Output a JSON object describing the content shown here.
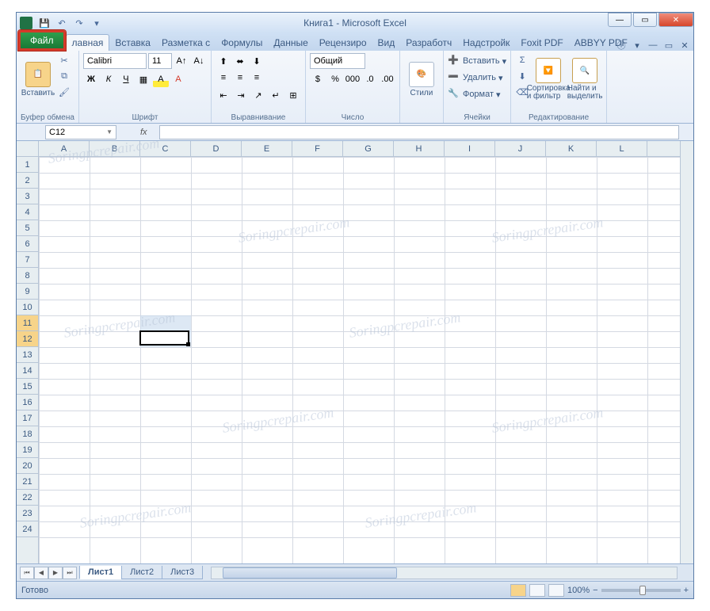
{
  "title": "Книга1 - Microsoft Excel",
  "qat": {
    "save": "💾",
    "undo": "↶",
    "redo": "↷"
  },
  "tabs": {
    "file": "Файл",
    "list": [
      "лавная",
      "Вставка",
      "Разметка с",
      "Формулы",
      "Данные",
      "Рецензиро",
      "Вид",
      "Разработч",
      "Надстройк",
      "Foxit PDF",
      "ABBYY PDF"
    ]
  },
  "ribbon": {
    "clipboard": {
      "paste": "Вставить",
      "label": "Буфер обмена"
    },
    "font": {
      "name": "Calibri",
      "size": "11",
      "label": "Шрифт",
      "bold": "Ж",
      "italic": "К",
      "underline": "Ч"
    },
    "align": {
      "label": "Выравнивание"
    },
    "number": {
      "format": "Общий",
      "label": "Число"
    },
    "styles": {
      "btn": "Стили",
      "label": ""
    },
    "cells": {
      "insert": "Вставить",
      "delete": "Удалить",
      "format": "Формат",
      "label": "Ячейки"
    },
    "editing": {
      "sort": "Сортировка\nи фильтр",
      "find": "Найти и\nвыделить",
      "label": "Редактирование"
    }
  },
  "namebox": "C12",
  "fx": "fx",
  "columns": [
    "A",
    "B",
    "C",
    "D",
    "E",
    "F",
    "G",
    "H",
    "I",
    "J",
    "K",
    "L"
  ],
  "rows": [
    "1",
    "2",
    "3",
    "4",
    "5",
    "6",
    "7",
    "8",
    "9",
    "10",
    "11",
    "12",
    "13",
    "14",
    "15",
    "16",
    "17",
    "18",
    "19",
    "20",
    "21",
    "22",
    "23",
    "24"
  ],
  "selected_rows": [
    11,
    12
  ],
  "active_cell": {
    "col": 2,
    "row": 11
  },
  "selection": {
    "col": 2,
    "row1": 10,
    "row2": 11
  },
  "sheets": {
    "list": [
      "Лист1",
      "Лист2",
      "Лист3"
    ],
    "active": 0
  },
  "status": {
    "ready": "Готово",
    "zoom": "100%"
  },
  "watermark": "Soringpcrepair.com"
}
